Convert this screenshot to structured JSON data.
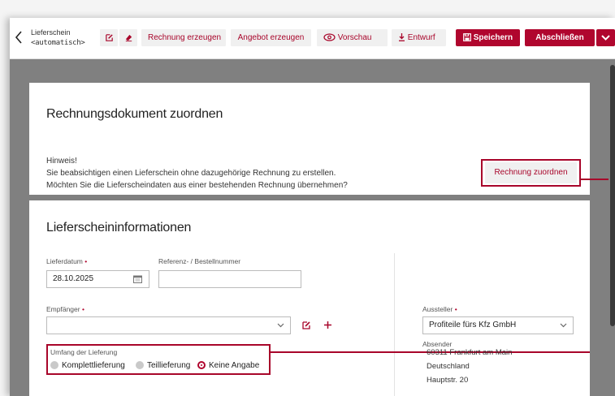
{
  "toolbar": {
    "doc_title": "Lieferschein",
    "doc_sub": "<automatisch>",
    "create_invoice": "Rechnung erzeugen",
    "create_offer": "Angebot erzeugen",
    "preview": "Vorschau",
    "draft": "Entwurf",
    "save": "Speichern",
    "finish": "Abschließen"
  },
  "assign_section": {
    "title": "Rechnungsdokument zuordnen",
    "hint_title": "Hinweis!",
    "hint_line1": "Sie beabsichtigen einen Lieferschein ohne dazugehörige Rechnung zu erstellen.",
    "hint_line2": "Möchten Sie die Lieferscheindaten aus einer bestehenden Rechnung übernehmen?",
    "assign_button": "Rechnung zuordnen"
  },
  "info_section": {
    "title": "Lieferscheininformationen",
    "delivery_date_label": "Lieferdatum",
    "delivery_date_value": "28.10.2025",
    "reference_label": "Referenz- / Bestellnummer",
    "reference_value": "",
    "recipient_label": "Empfänger",
    "recipient_value": "",
    "scope_label": "Umfang der Lieferung",
    "scope_options": [
      "Komplettlieferung",
      "Teillieferung",
      "Keine Angabe"
    ],
    "scope_selected": "Keine Angabe",
    "issuer_label": "Aussteller",
    "issuer_value": "Profiteile fürs Kfz GmbH",
    "sender_label": "Absender",
    "sender_lines": [
      "60311 Frankfurt am Main",
      "Deutschland",
      "Hauptstr. 20"
    ]
  },
  "colors": {
    "accent": "#b0062e",
    "overlay": "#808080"
  }
}
